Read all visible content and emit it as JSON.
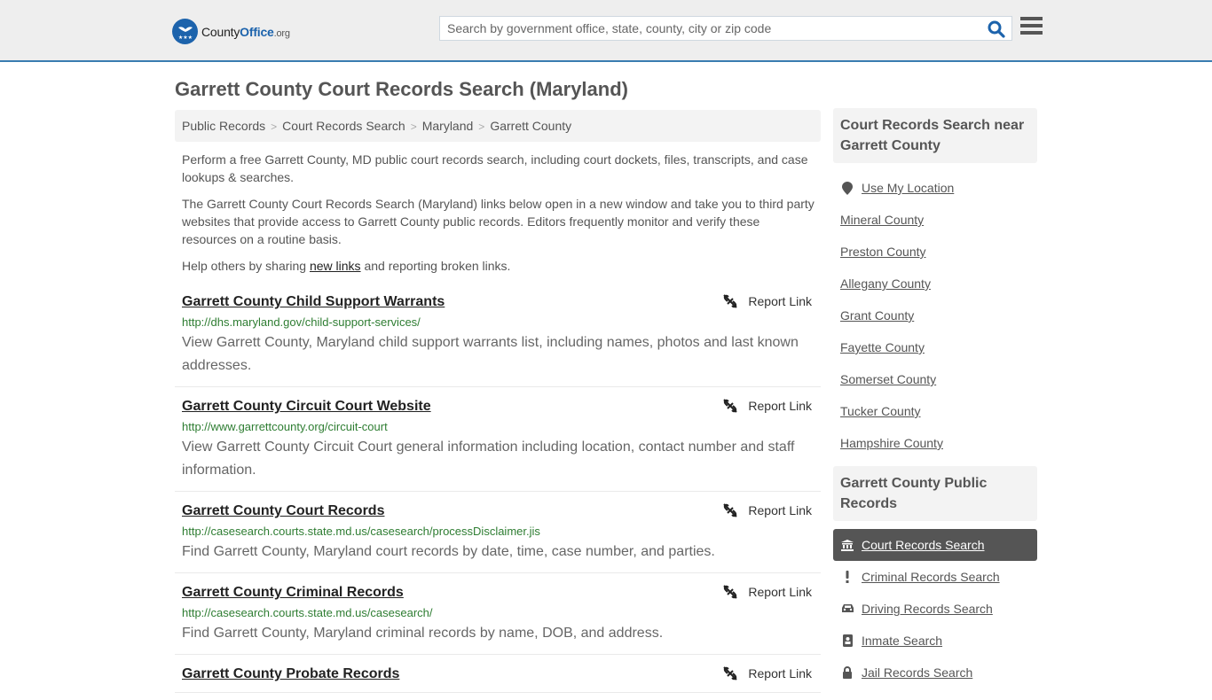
{
  "header": {
    "logo": {
      "county": "County",
      "office": "Office",
      "org": ".org"
    },
    "search_placeholder": "Search by government office, state, county, city or zip code",
    "search_icon": "search-icon",
    "menu_icon": "hamburger-menu-icon"
  },
  "page": {
    "title": "Garrett County Court Records Search (Maryland)",
    "breadcrumb": [
      "Public Records",
      "Court Records Search",
      "Maryland",
      "Garrett County"
    ],
    "intro": [
      "Perform a free Garrett County, MD public court records search, including court dockets, files, transcripts, and case lookups & searches.",
      "The Garrett County Court Records Search (Maryland) links below open in a new window and take you to third party websites that provide access to Garrett County public records. Editors frequently monitor and verify these resources on a routine basis."
    ],
    "help": {
      "before": "Help others by sharing ",
      "link": "new links",
      "after": " and reporting broken links."
    }
  },
  "results": [
    {
      "title": "Garrett County Child Support Warrants",
      "url": "http://dhs.maryland.gov/child-support-services/",
      "desc": "View Garrett County, Maryland child support warrants list, including names, photos and last known addresses.",
      "report": "Report Link"
    },
    {
      "title": "Garrett County Circuit Court Website",
      "url": "http://www.garrettcounty.org/circuit-court",
      "desc": "View Garrett County Circuit Court general information including location, contact number and staff information.",
      "report": "Report Link"
    },
    {
      "title": "Garrett County Court Records",
      "url": "http://casesearch.courts.state.md.us/casesearch/processDisclaimer.jis",
      "desc": "Find Garrett County, Maryland court records by date, time, case number, and parties.",
      "report": "Report Link"
    },
    {
      "title": "Garrett County Criminal Records",
      "url": "http://casesearch.courts.state.md.us/casesearch/",
      "desc": "Find Garrett County, Maryland criminal records by name, DOB, and address.",
      "report": "Report Link"
    },
    {
      "title": "Garrett County Probate Records",
      "url": "",
      "desc": "",
      "report": "Report Link"
    }
  ],
  "sidebar": {
    "nearby": {
      "heading": "Court Records Search near Garrett County",
      "use_location": "Use My Location",
      "counties": [
        "Mineral County",
        "Preston County",
        "Allegany County",
        "Grant County",
        "Fayette County",
        "Somerset County",
        "Tucker County",
        "Hampshire County"
      ]
    },
    "public_records": {
      "heading": "Garrett County Public Records",
      "items": [
        {
          "label": "Court Records Search",
          "icon": "courthouse-icon",
          "active": true
        },
        {
          "label": "Criminal Records Search",
          "icon": "exclamation-icon",
          "active": false
        },
        {
          "label": "Driving Records Search",
          "icon": "car-icon",
          "active": false
        },
        {
          "label": "Inmate Search",
          "icon": "id-badge-icon",
          "active": false
        },
        {
          "label": "Jail Records Search",
          "icon": "lock-icon",
          "active": false
        }
      ]
    }
  },
  "colors": {
    "brand_blue": "#1c63ac",
    "url_green": "#2e7d32",
    "active_bg": "#555555",
    "header_border": "#3a7cb0"
  }
}
